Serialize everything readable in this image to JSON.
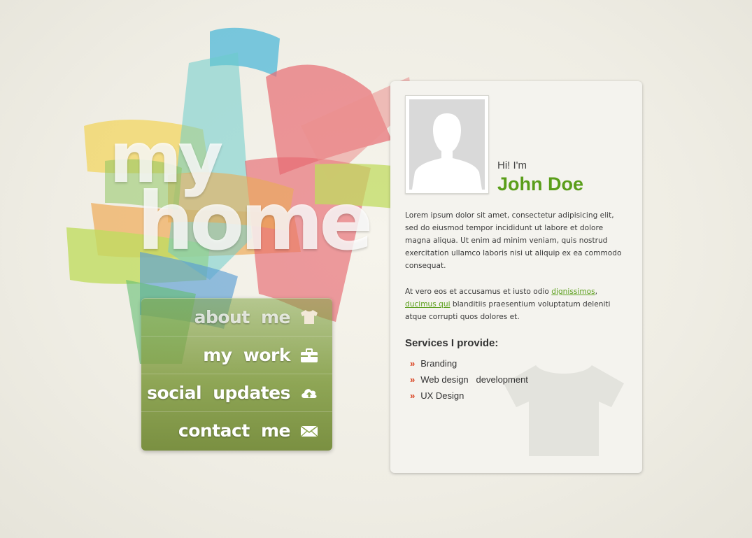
{
  "logo": {
    "line1": "my",
    "line2": "home"
  },
  "nav": {
    "items": [
      {
        "label": "about me",
        "icon": "tshirt-icon"
      },
      {
        "label": "my work",
        "icon": "briefcase-icon"
      },
      {
        "label": "social updates",
        "icon": "cloud-upload-icon"
      },
      {
        "label": "contact me",
        "icon": "envelope-icon"
      }
    ]
  },
  "profile": {
    "greeting": "Hi! I'm",
    "name": "John Doe",
    "avatar_icon": "user-placeholder-icon",
    "bio_paragraph1": "Lorem ipsum dolor sit amet, consectetur adipisicing elit, sed do eiusmod tempor incididunt ut labore et dolore magna aliqua. Ut enim ad minim veniam, quis nostrud exercitation ullamco laboris nisi ut aliquip ex ea commodo consequat.",
    "bio_paragraph2_prefix": "At vero eos et accusamus et iusto odio ",
    "bio_link1": "dignissimos",
    "bio_separator": ",",
    "bio_link2": "ducimus qui",
    "bio_paragraph2_suffix": " blanditiis praesentium voluptatum deleniti atque corrupti quos dolores et."
  },
  "services": {
    "title": "Services I provide:",
    "bullet": "»",
    "items": [
      "Branding",
      "Web design   development",
      "UX Design"
    ],
    "watermark_icon": "tshirt-icon"
  },
  "colors": {
    "accent_green": "#5a9e1a",
    "bullet_red": "#d9401e",
    "nav_green": "#84a046",
    "card_bg": "#f4f3ee"
  }
}
